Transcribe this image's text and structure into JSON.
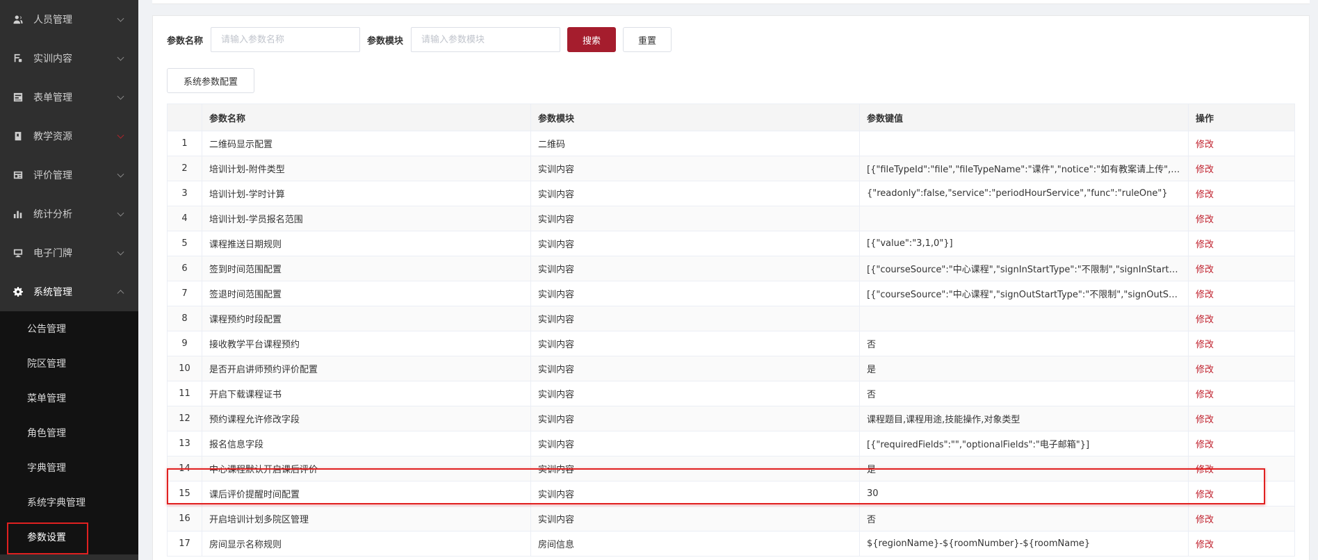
{
  "sidebar": {
    "top_items": [
      {
        "label": "人员管理",
        "icon": "person-icon"
      },
      {
        "label": "实训内容",
        "icon": "training-icon"
      },
      {
        "label": "表单管理",
        "icon": "form-icon"
      },
      {
        "label": "教学资源",
        "icon": "book-icon"
      },
      {
        "label": "评价管理",
        "icon": "evaluation-icon"
      },
      {
        "label": "统计分析",
        "icon": "bar-chart-icon"
      },
      {
        "label": "电子门牌",
        "icon": "monitor-icon"
      },
      {
        "label": "系统管理",
        "icon": "gear-icon"
      }
    ],
    "sub_items": [
      "公告管理",
      "院区管理",
      "菜单管理",
      "角色管理",
      "字典管理",
      "系统字典管理",
      "参数设置"
    ]
  },
  "search": {
    "name_label": "参数名称",
    "name_placeholder": "请输入参数名称",
    "module_label": "参数模块",
    "module_placeholder": "请输入参数模块",
    "search_button": "搜索",
    "reset_button": "重置"
  },
  "toolbar": {
    "config_button": "系统参数配置"
  },
  "table": {
    "headers": [
      "",
      "参数名称",
      "参数模块",
      "参数键值",
      "操作"
    ],
    "rows": [
      {
        "index": "1",
        "name": "二维码显示配置",
        "module": "二维码",
        "value": "",
        "op": "修改"
      },
      {
        "index": "2",
        "name": "培训计划-附件类型",
        "module": "实训内容",
        "value": "[{\"fileTypeId\":\"file\",\"fileTypeName\":\"课件\",\"notice\":\"如有教案请上传\",\"fil…",
        "op": "修改"
      },
      {
        "index": "3",
        "name": "培训计划-学时计算",
        "module": "实训内容",
        "value": "{\"readonly\":false,\"service\":\"periodHourService\",\"func\":\"ruleOne\"}",
        "op": "修改"
      },
      {
        "index": "4",
        "name": "培训计划-学员报名范围",
        "module": "实训内容",
        "value": "",
        "op": "修改"
      },
      {
        "index": "5",
        "name": "课程推送日期规则",
        "module": "实训内容",
        "value": "[{\"value\":\"3,1,0\"}]",
        "op": "修改"
      },
      {
        "index": "6",
        "name": "签到时间范围配置",
        "module": "实训内容",
        "value": "[{\"courseSource\":\"中心课程\",\"signInStartType\":\"不限制\",\"signInStartTi…",
        "op": "修改"
      },
      {
        "index": "7",
        "name": "签退时间范围配置",
        "module": "实训内容",
        "value": "[{\"courseSource\":\"中心课程\",\"signOutStartType\":\"不限制\",\"signOutStar…",
        "op": "修改"
      },
      {
        "index": "8",
        "name": "课程预约时段配置",
        "module": "实训内容",
        "value": "",
        "op": "修改"
      },
      {
        "index": "9",
        "name": "接收教学平台课程预约",
        "module": "实训内容",
        "value": "否",
        "op": "修改"
      },
      {
        "index": "10",
        "name": "是否开启讲师预约评价配置",
        "module": "实训内容",
        "value": "是",
        "op": "修改"
      },
      {
        "index": "11",
        "name": "开启下载课程证书",
        "module": "实训内容",
        "value": "否",
        "op": "修改"
      },
      {
        "index": "12",
        "name": "预约课程允许修改字段",
        "module": "实训内容",
        "value": "课程题目,课程用途,技能操作,对象类型",
        "op": "修改"
      },
      {
        "index": "13",
        "name": "报名信息字段",
        "module": "实训内容",
        "value": "[{\"requiredFields\":\"\",\"optionalFields\":\"电子邮箱\"}]",
        "op": "修改"
      },
      {
        "index": "14",
        "name": "中心课程默认开启课后评价",
        "module": "实训内容",
        "value": "是",
        "op": "修改"
      },
      {
        "index": "15",
        "name": "课后评价提醒时间配置",
        "module": "实训内容",
        "value": "30",
        "op": "修改"
      },
      {
        "index": "16",
        "name": "开启培训计划多院区管理",
        "module": "实训内容",
        "value": "否",
        "op": "修改"
      },
      {
        "index": "17",
        "name": "房间显示名称规则",
        "module": "房间信息",
        "value": "${regionName}-${roomNumber}-${roomName}",
        "op": "修改"
      }
    ]
  },
  "colors": {
    "primary": "#a51d2d",
    "sidebar_bg": "#2f2f2f",
    "submenu_bg": "#121212",
    "highlight": "#e02020"
  }
}
